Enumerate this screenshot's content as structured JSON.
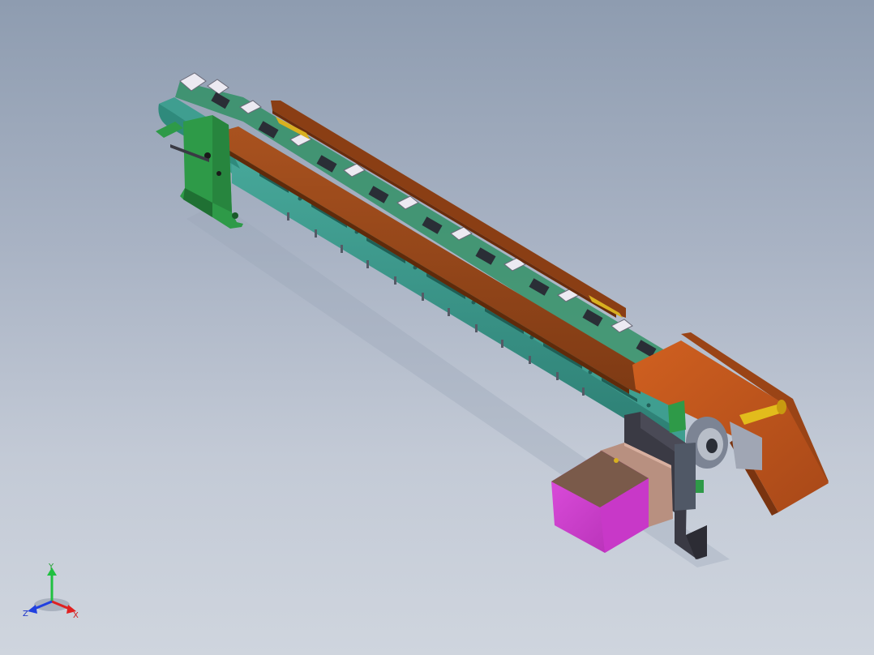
{
  "viewport": {
    "background_top": "#8e9cb0",
    "background_bottom": "#cfd5de"
  },
  "model": {
    "parts": {
      "frame_color": "#3a9a8a",
      "guide_rail_color": "#9c4a1c",
      "bracket_color": "#2e9a48",
      "motor_color": "#c838c8",
      "motor_face_color": "#b89080",
      "motor_mount_color": "#3a3a44",
      "idler_pin_color": "#d8b020",
      "fixture_color": "#eceaf2"
    }
  },
  "triad": {
    "y_label": "Y",
    "x_label": "X",
    "z_label": "Z",
    "y_color": "#20c040",
    "x_color": "#e02020",
    "z_color": "#2040e0"
  }
}
